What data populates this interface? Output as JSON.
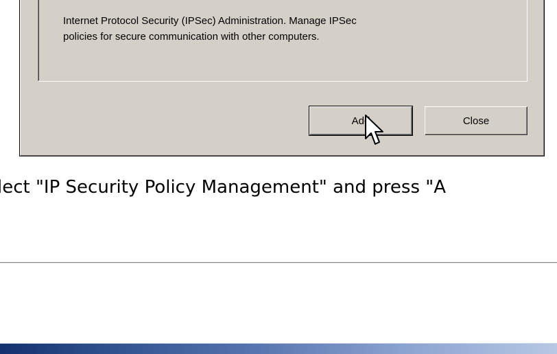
{
  "dialog": {
    "description": "Internet Protocol Security (IPSec) Administration. Manage IPSec\npolicies for secure communication with other computers.",
    "add_label": "Add",
    "close_label": "Close"
  },
  "instruction": "elect \"IP Security Policy Management\" and press \"A",
  "icons": {
    "cursor": "mouse-pointer-icon"
  },
  "colors": {
    "dialog_face": "#d4d0c8",
    "footer_band_dark": "#14306e",
    "footer_band_light": "#b7c8e4"
  }
}
